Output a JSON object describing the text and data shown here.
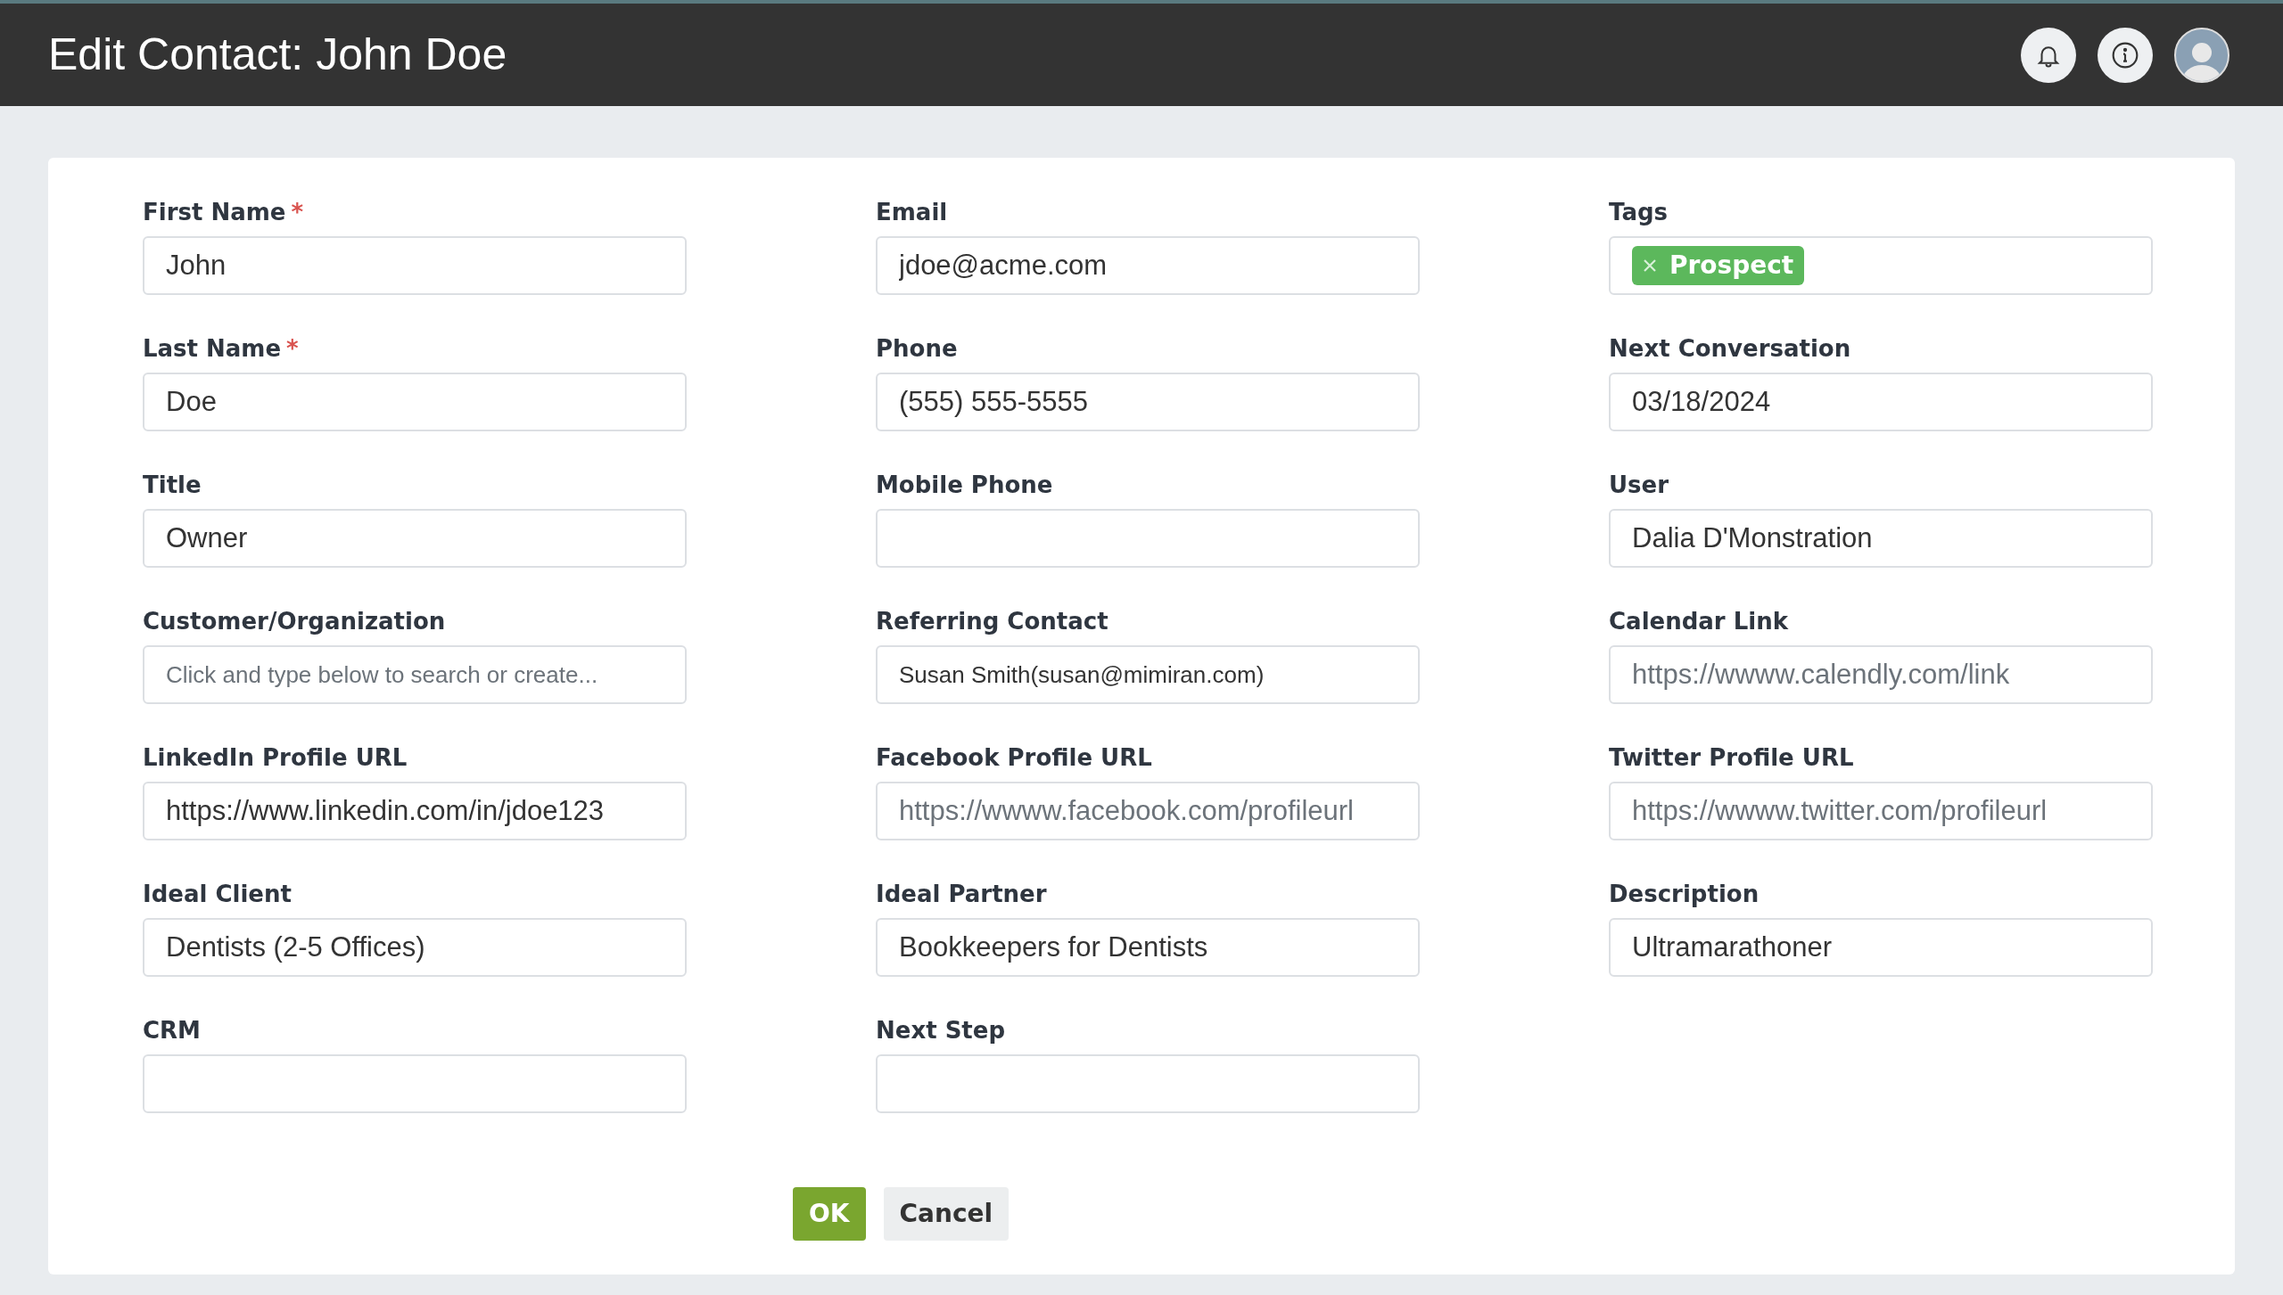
{
  "header": {
    "title": "Edit Contact: John Doe"
  },
  "fields": [
    {
      "kind": "text",
      "label": "First Name",
      "required_mark": "*",
      "value": "John"
    },
    {
      "kind": "text",
      "label": "Email",
      "value": "jdoe@acme.com"
    },
    {
      "kind": "tags",
      "label": "Tags",
      "tags": [
        {
          "label": "Prospect",
          "color": "#5cb85c"
        }
      ]
    },
    {
      "kind": "text",
      "label": "Last Name",
      "required_mark": "*",
      "value": "Doe"
    },
    {
      "kind": "text",
      "label": "Phone",
      "value": "(555) 555-5555"
    },
    {
      "kind": "text",
      "label": "Next Conversation",
      "value": "03/18/2024"
    },
    {
      "kind": "text",
      "label": "Title",
      "value": "Owner"
    },
    {
      "kind": "text",
      "label": "Mobile Phone"
    },
    {
      "kind": "text",
      "label": "User",
      "value": "Dalia D'Monstration"
    },
    {
      "kind": "search",
      "label": "Customer/Organization",
      "placeholder": "Click and type below to search or create..."
    },
    {
      "kind": "search",
      "label": "Referring Contact",
      "value": "Susan Smith(susan@mimiran.com)"
    },
    {
      "kind": "text",
      "label": "Calendar Link",
      "placeholder": "https://wwww.calendly.com/link"
    },
    {
      "kind": "text",
      "label": "LinkedIn Profile URL",
      "value": "https://www.linkedin.com/in/jdoe123"
    },
    {
      "kind": "text",
      "label": "Facebook Profile URL",
      "placeholder": "https://wwww.facebook.com/profileurl"
    },
    {
      "kind": "text",
      "label": "Twitter Profile URL",
      "placeholder": "https://wwww.twitter.com/profileurl"
    },
    {
      "kind": "text",
      "label": "Ideal Client",
      "value": "Dentists (2-5 Offices)"
    },
    {
      "kind": "text",
      "label": "Ideal Partner",
      "value": "Bookkeepers for Dentists"
    },
    {
      "kind": "text",
      "label": "Description",
      "value": "Ultramarathoner"
    },
    {
      "kind": "text",
      "label": "CRM"
    },
    {
      "kind": "text",
      "label": "Next Step"
    }
  ],
  "buttons": [
    {
      "kind": "primary",
      "label": "OK"
    },
    {
      "kind": "secondary",
      "label": "Cancel"
    }
  ]
}
